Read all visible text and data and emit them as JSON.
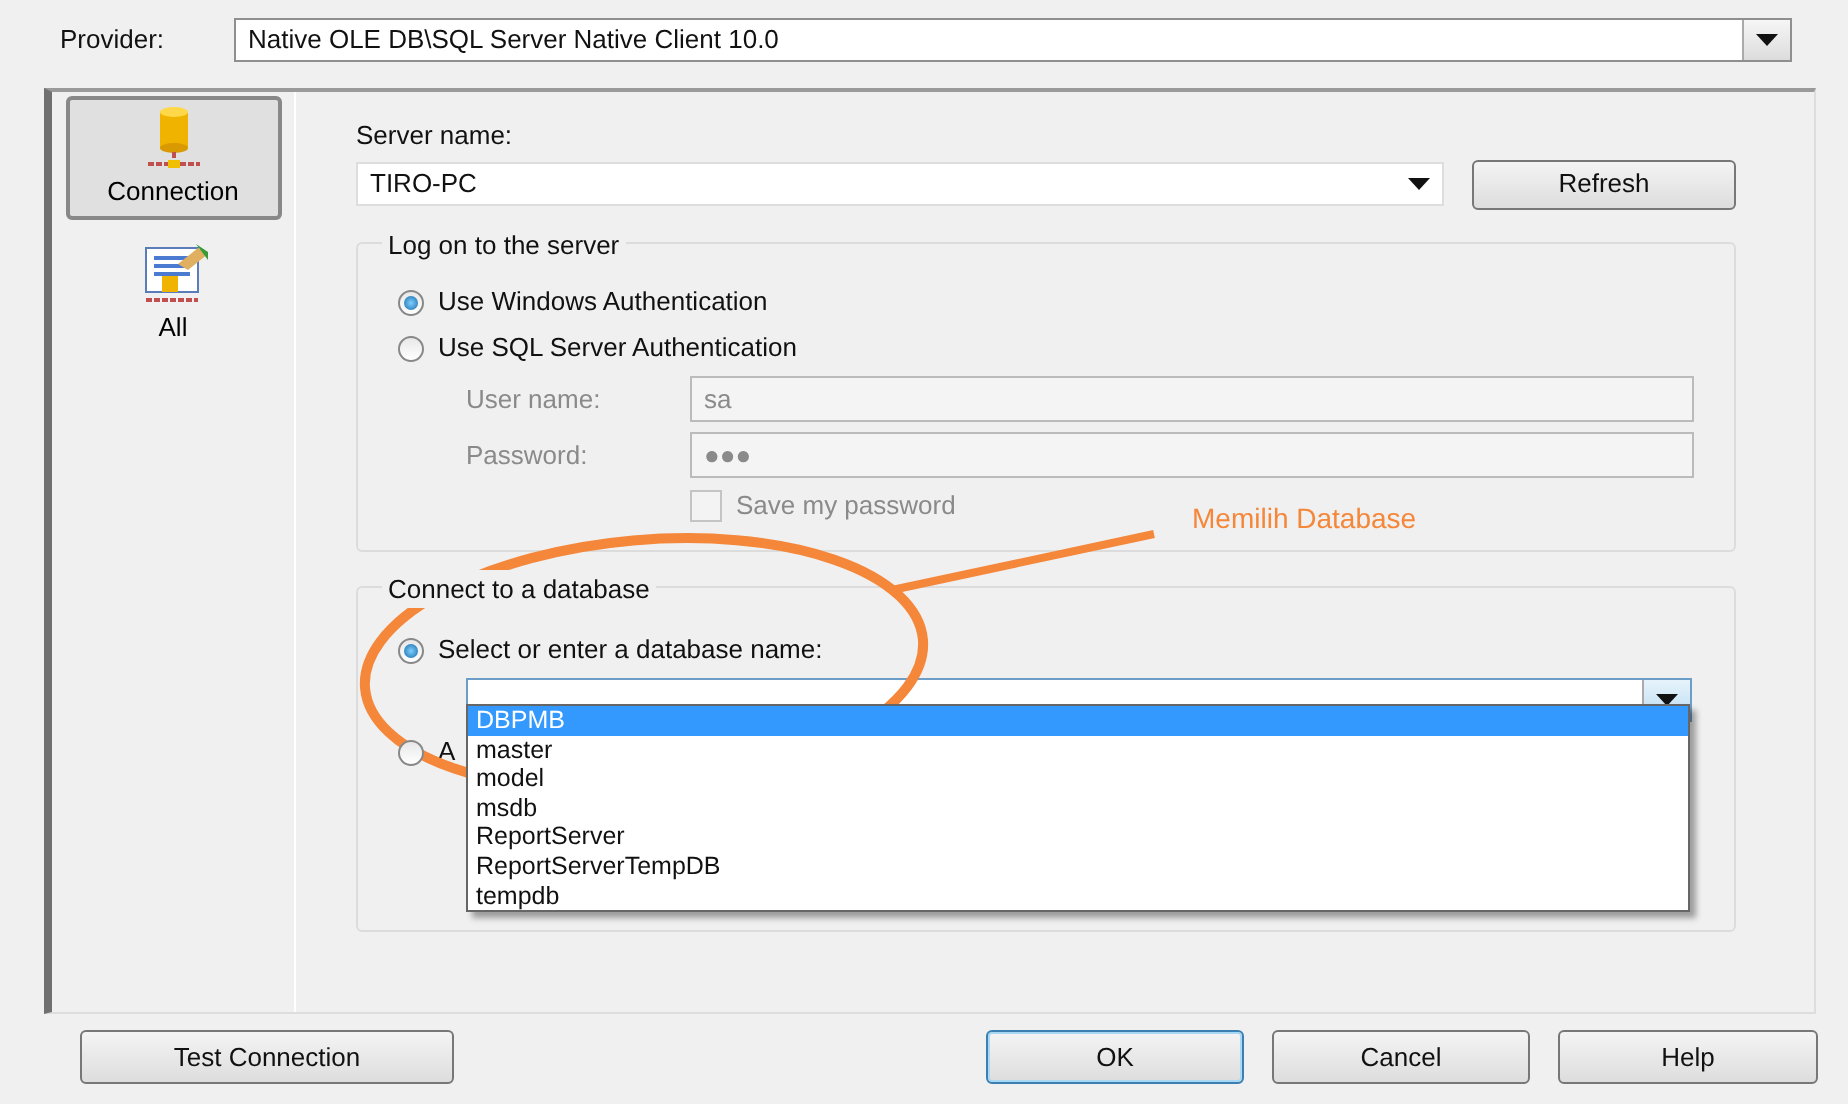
{
  "provider": {
    "label": "Provider:",
    "value": "Native OLE DB\\SQL Server Native Client 10.0"
  },
  "sidebar": {
    "items": [
      {
        "kind": "connection",
        "label": "Connection",
        "selected": true
      },
      {
        "kind": "all",
        "label": "All",
        "selected": false
      }
    ]
  },
  "server": {
    "label": "Server name:",
    "value": "TIRO-PC",
    "refresh_button": "Refresh"
  },
  "logon": {
    "title": "Log on to the server",
    "options": [
      {
        "label": "Use Windows Authentication",
        "selected": true
      },
      {
        "label": "Use SQL Server Authentication",
        "selected": false
      }
    ],
    "user_name": {
      "label": "User name:",
      "value": "sa",
      "disabled": true
    },
    "password": {
      "label": "Password:",
      "value": "●●●",
      "disabled": true
    },
    "save_password": {
      "label": "Save my password",
      "checked": false,
      "disabled": true
    }
  },
  "database": {
    "title": "Connect to a database",
    "options": [
      {
        "label": "Select or enter a database name:",
        "selected": true
      },
      {
        "label": "A",
        "selected": false
      }
    ],
    "dropdown": {
      "expanded": true,
      "items": [
        {
          "label": "DBPMB",
          "selected": true
        },
        {
          "label": "master",
          "selected": false
        },
        {
          "label": "model",
          "selected": false
        },
        {
          "label": "msdb",
          "selected": false
        },
        {
          "label": "ReportServer",
          "selected": false
        },
        {
          "label": "ReportServerTempDB",
          "selected": false
        },
        {
          "label": "tempdb",
          "selected": false
        }
      ]
    }
  },
  "annotation": {
    "label": "Memilih Database"
  },
  "buttons": [
    {
      "label": "Test Connection",
      "default": false
    },
    {
      "label": "OK",
      "default": true
    },
    {
      "label": "Cancel",
      "default": false
    },
    {
      "label": "Help",
      "default": false
    }
  ]
}
